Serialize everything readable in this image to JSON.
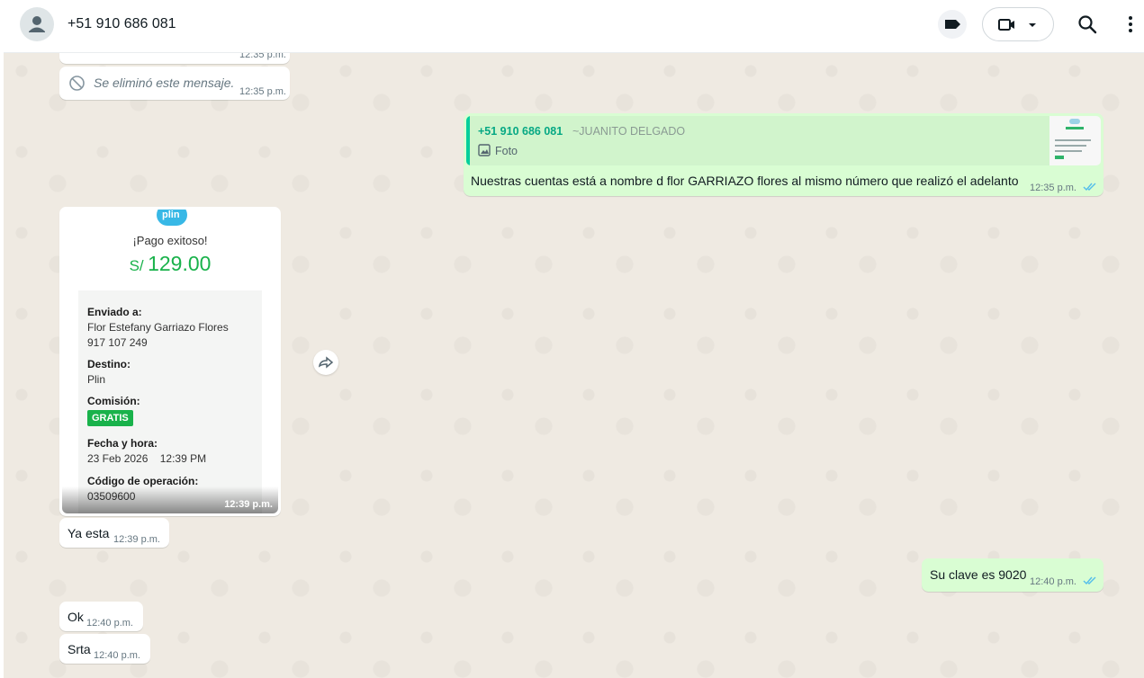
{
  "header": {
    "contact_name": "+51 910 686 081"
  },
  "messages": {
    "m0_time": "12:35 p.m.",
    "m1_text": "Se eliminó este mensaje.",
    "m1_time": "12:35 p.m.",
    "m2_quote_author": "+51 910 686 081",
    "m2_quote_author_name": "~JUANITO DELGADO",
    "m2_quote_type": "Foto",
    "m2_text": "Nuestras cuentas está a nombre d flor GARRIAZO flores al mismo número que realizó el adelanto",
    "m2_time": "12:35 p.m.",
    "m3_receipt": {
      "logo": "plin",
      "status": "¡Pago exitoso!",
      "currency": "S/",
      "amount": "129.00",
      "sent_to_label": "Enviado a:",
      "sent_to_name": "Flor Estefany Garriazo Flores",
      "sent_to_phone": "917 107 249",
      "destination_label": "Destino:",
      "destination": "Plin",
      "fee_label": "Comisión:",
      "fee": "GRATIS",
      "date_label": "Fecha y hora:",
      "date": "23 Feb 2026    12:39 PM",
      "op_label": "Código de operación:",
      "op_code": "03509600"
    },
    "m3_time": "12:39 p.m.",
    "m4_text": "Ya esta",
    "m4_time": "12:39 p.m.",
    "m5_text": "Su clave es 9020",
    "m5_time": "12:40 p.m.",
    "m6_text": "Ok",
    "m6_time": "12:40 p.m.",
    "m7_text": "Srta",
    "m7_time": "12:40 p.m."
  },
  "icons": {
    "avatar": "person-icon",
    "label": "label-icon",
    "video": "video-call-icon",
    "dropdown": "chevron-down-icon",
    "search": "search-icon",
    "menu": "kebab-menu-icon",
    "forward": "forward-icon",
    "deleted": "blocked-icon",
    "photo": "photo-icon",
    "read": "double-check-icon"
  },
  "colors": {
    "outgoing_bubble": "#d9fdd3",
    "incoming_bubble": "#ffffff",
    "read_ticks": "#53bdeb",
    "chat_bg": "#efeae2",
    "amount_green": "#19b24b"
  }
}
